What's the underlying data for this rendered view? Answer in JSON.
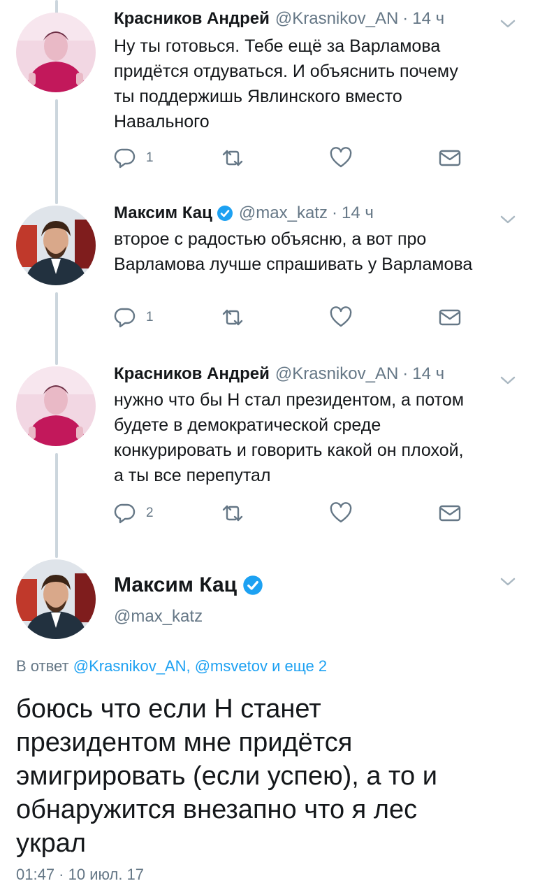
{
  "tweets": [
    {
      "name": "Красников Андрей",
      "handle": "@Krasnikov_AN",
      "sep": "·",
      "time": "14 ч",
      "text_lines": [
        "Ну ты готовься. Тебе ещё за Варламова",
        "придётся отдуваться. И объяснить почему",
        "ты поддержишь Явлинского вместо",
        "Навального"
      ],
      "reply_count": "1",
      "verified": false
    },
    {
      "name": "Максим Кац",
      "handle": "@max_katz",
      "sep": "·",
      "time": "14 ч",
      "text_lines": [
        "второе с радостью объясню, а вот про",
        "Варламова лучше спрашивать у Варламова"
      ],
      "reply_count": "1",
      "verified": true
    },
    {
      "name": "Красников Андрей",
      "handle": "@Krasnikov_AN",
      "sep": "·",
      "time": "14 ч",
      "text_lines": [
        "нужно что бы Н стал президентом, а потом",
        "будете в демократической среде",
        "конкурировать и говорить какой он плохой,",
        "а ты все перепутал"
      ],
      "reply_count": "2",
      "verified": false
    }
  ],
  "main_tweet": {
    "name": "Максим Кац",
    "handle": "@max_katz",
    "reply_prefix": "В ответ",
    "reply_to": "@Krasnikov_AN, @msvetov и еще 2",
    "text_lines": [
      "боюсь что если Н станет",
      "президентом мне придётся",
      "эмигрировать (если успею), а то и",
      "обнаружится внезапно что я лес",
      "украл"
    ],
    "timestamp": "01:47 · 10 июл. 17"
  },
  "icons": {
    "reply": "reply-icon",
    "retweet": "retweet-icon",
    "like": "heart-icon",
    "dm": "envelope-icon",
    "caret": "chevron-down-icon",
    "verified": "verified-badge-icon"
  },
  "colors": {
    "text": "#14171a",
    "secondary": "#657786",
    "link": "#1da1f2",
    "thread_line": "#ccd6dd"
  }
}
